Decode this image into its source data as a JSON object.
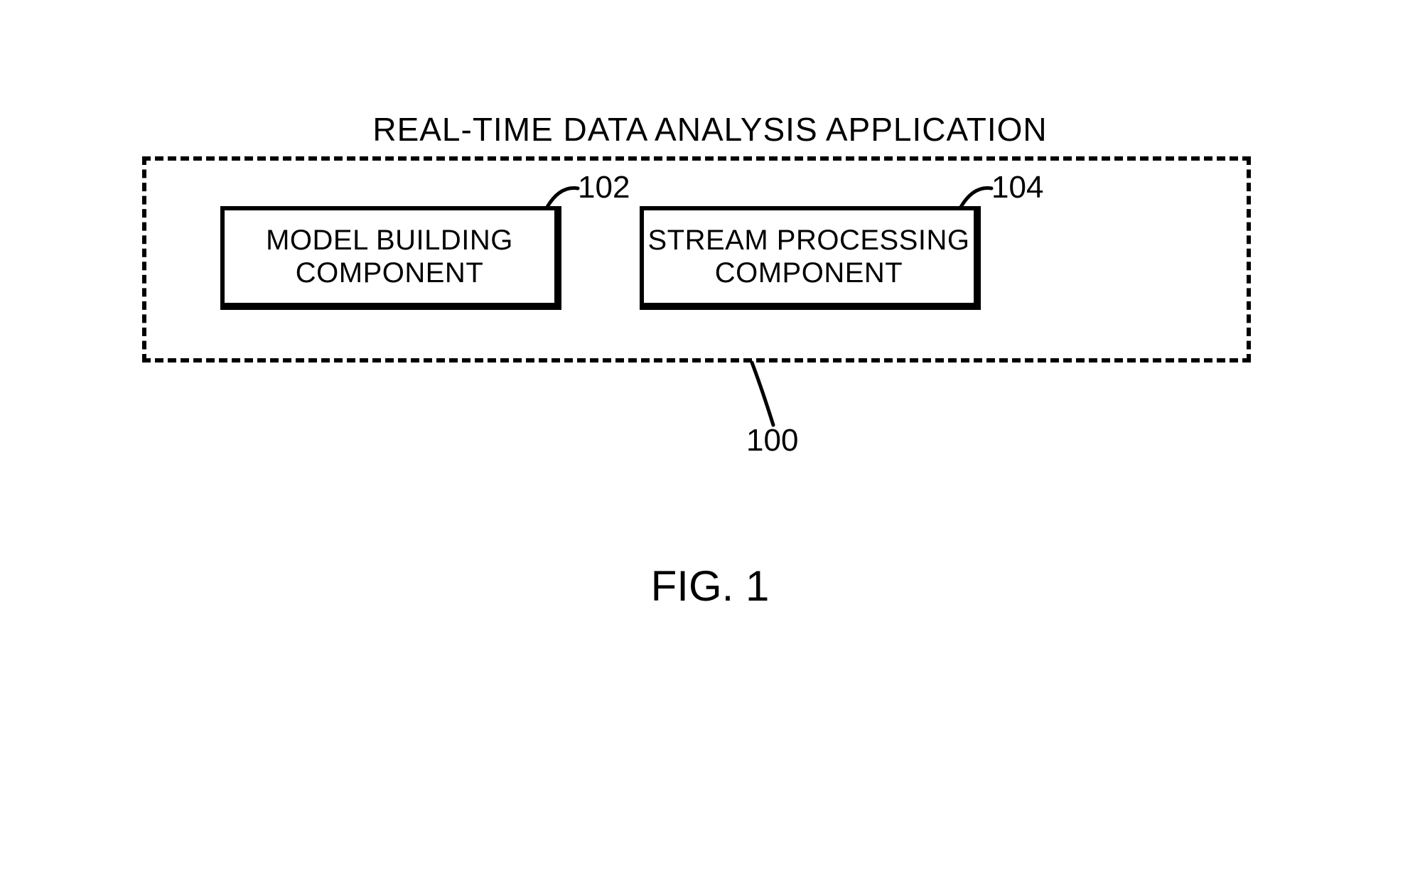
{
  "diagram": {
    "title": "REAL-TIME DATA ANALYSIS APPLICATION",
    "figure_caption": "FIG. 1",
    "container_ref": "100",
    "blocks": {
      "left": {
        "label": "MODEL BUILDING\nCOMPONENT",
        "ref": "102"
      },
      "right": {
        "label": "STREAM PROCESSING\nCOMPONENT",
        "ref": "104"
      }
    }
  }
}
